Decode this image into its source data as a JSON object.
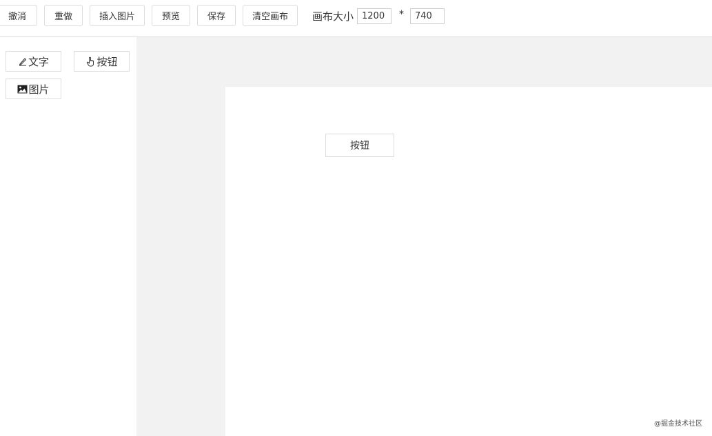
{
  "toolbar": {
    "undo_label": "撤消",
    "redo_label": "重做",
    "insert_image_label": "插入图片",
    "preview_label": "预览",
    "save_label": "保存",
    "clear_canvas_label": "清空画布",
    "canvas_size_label": "画布大小",
    "width_value": "1200",
    "times_symbol": "*",
    "height_value": "740"
  },
  "sidebar": {
    "items": [
      {
        "label": "文字",
        "icon": "pencil-icon"
      },
      {
        "label": "按钮",
        "icon": "hand-pointer-icon"
      },
      {
        "label": "图片",
        "icon": "image-icon"
      }
    ]
  },
  "canvas": {
    "elements": [
      {
        "type": "button",
        "label": "按钮"
      }
    ]
  },
  "watermark": "@掘金技术社区",
  "colors": {
    "border": "#dcdcdc",
    "workspace_bg": "#f2f2f2",
    "canvas_bg": "#ffffff"
  }
}
